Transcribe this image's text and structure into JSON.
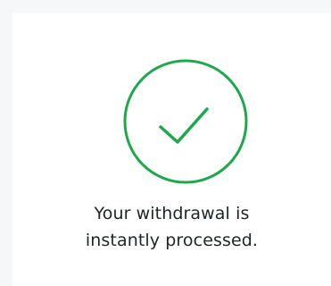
{
  "success": {
    "icon": "check-circle-icon",
    "color": "#1ea84a",
    "message_line1": "Your withdrawal is",
    "message_line2": "instantly processed."
  }
}
